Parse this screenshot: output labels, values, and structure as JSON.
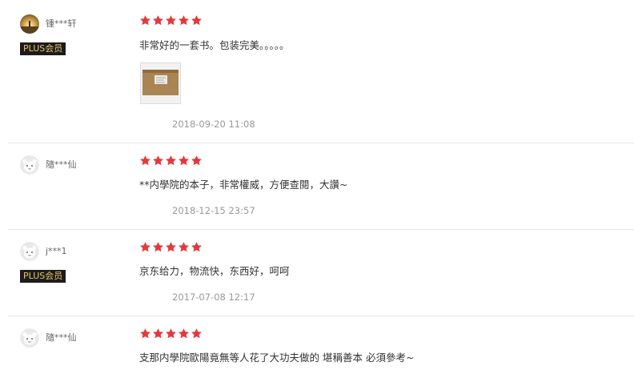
{
  "colors": {
    "star": "#e4393c",
    "badge_bg": "#1c1c1c",
    "badge_text": "#e8c46a",
    "date": "#999999"
  },
  "reviews": [
    {
      "username": "锺***轩",
      "plus_badge": "PLUS会员",
      "rating": 5,
      "content": "非常好的一套书。包装完美。。。。。",
      "has_image": true,
      "date": "2018-09-20 11:08",
      "avatar_icon": "sunset-avatar-icon"
    },
    {
      "username": "隨***仙",
      "plus_badge": "",
      "rating": 5,
      "content": "**内學院的本子，非常權威，方便查閱，大讚~",
      "has_image": false,
      "date": "2018-12-15 23:57",
      "avatar_icon": "default-avatar-icon"
    },
    {
      "username": "j***1",
      "plus_badge": "PLUS会员",
      "rating": 5,
      "content": "京东给力，物流快，东西好，呵呵",
      "has_image": false,
      "date": "2017-07-08 12:17",
      "avatar_icon": "default-avatar-icon"
    },
    {
      "username": "隨***仙",
      "plus_badge": "",
      "rating": 5,
      "content": "支那内學院歐陽竟無等人花了大功夫做的 堪稱善本 必須參考~",
      "has_image": false,
      "date": "",
      "avatar_icon": "default-avatar-icon"
    }
  ]
}
